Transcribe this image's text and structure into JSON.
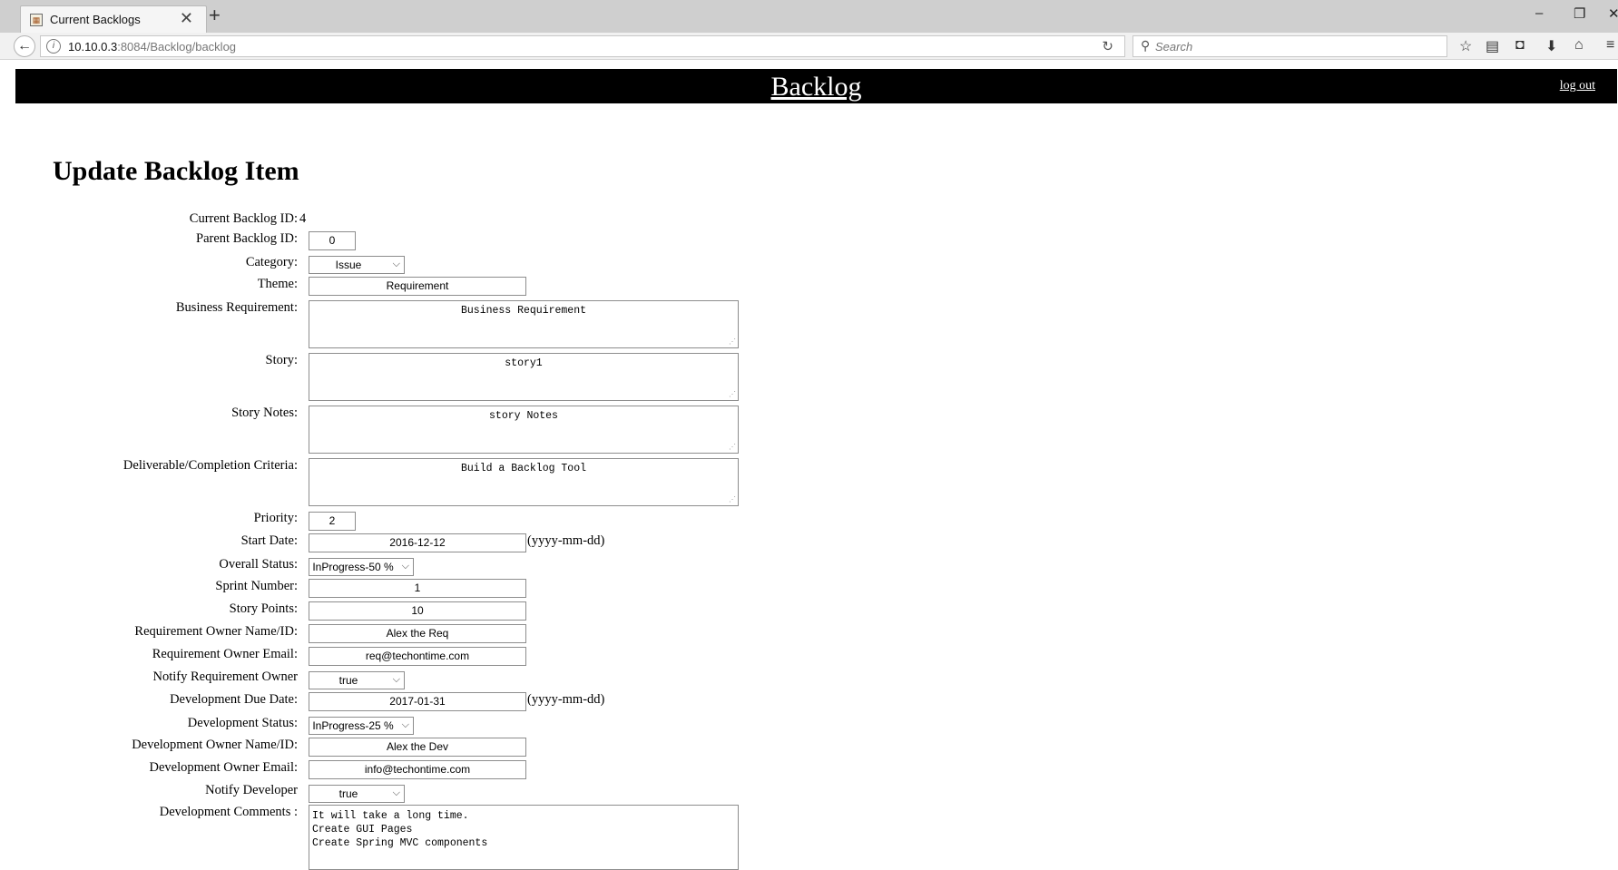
{
  "browser": {
    "tab_title": "Current Backlogs",
    "tab_close": "✕",
    "new_tab": "+",
    "url_host": "10.10.0.3",
    "url_path": ":8084/Backlog/backlog",
    "search_placeholder": "Search",
    "icons": [
      "back-arrow-icon",
      "info-icon",
      "reload-icon",
      "search-icon",
      "bookmark-star-icon",
      "reading-list-icon",
      "pocket-icon",
      "download-icon",
      "home-icon",
      "menu-icon"
    ]
  },
  "header": {
    "title": "Backlog",
    "logout": "log out"
  },
  "form": {
    "title": "Update Backlog Item",
    "current_id_label": "Current Backlog ID:",
    "current_id_value": "4",
    "parent_id_label": "Parent Backlog ID:",
    "parent_id_value": "0",
    "category_label": "Category:",
    "category_value": "Issue",
    "theme_label": "Theme:",
    "theme_value": "Requirement",
    "business_req_label": "Business Requirement:",
    "business_req_value": "Business Requirement",
    "story_label": "Story:",
    "story_value": "story1",
    "story_notes_label": "Story Notes:",
    "story_notes_value": "story Notes",
    "deliverable_label": "Deliverable/Completion Criteria:",
    "deliverable_value": "Build a Backlog Tool",
    "priority_label": "Priority:",
    "priority_value": "2",
    "start_date_label": "Start Date:",
    "start_date_value": "2016-12-12",
    "date_hint": "(yyyy-mm-dd)",
    "overall_status_label": "Overall Status:",
    "overall_status_value": "InProgress-50 %",
    "sprint_label": "Sprint Number:",
    "sprint_value": "1",
    "story_points_label": "Story Points:",
    "story_points_value": "10",
    "req_owner_label": "Requirement Owner Name/ID:",
    "req_owner_value": "Alex the Req",
    "req_email_label": "Requirement Owner Email:",
    "req_email_value": "req@techontime.com",
    "notify_req_label": "Notify Requirement Owner",
    "notify_req_value": "true",
    "dev_due_label": "Development Due Date:",
    "dev_due_value": "2017-01-31",
    "dev_status_label": "Development Status:",
    "dev_status_value": "InProgress-25 %",
    "dev_owner_label": "Development Owner Name/ID:",
    "dev_owner_value": "Alex the Dev",
    "dev_email_label": "Development Owner Email:",
    "dev_email_value": "info@techontime.com",
    "notify_dev_label": "Notify Developer",
    "notify_dev_value": "true",
    "dev_comments_label": "Development Comments :",
    "dev_comments_value": "It will take a long time.\nCreate GUI Pages\nCreate Spring MVC components"
  }
}
